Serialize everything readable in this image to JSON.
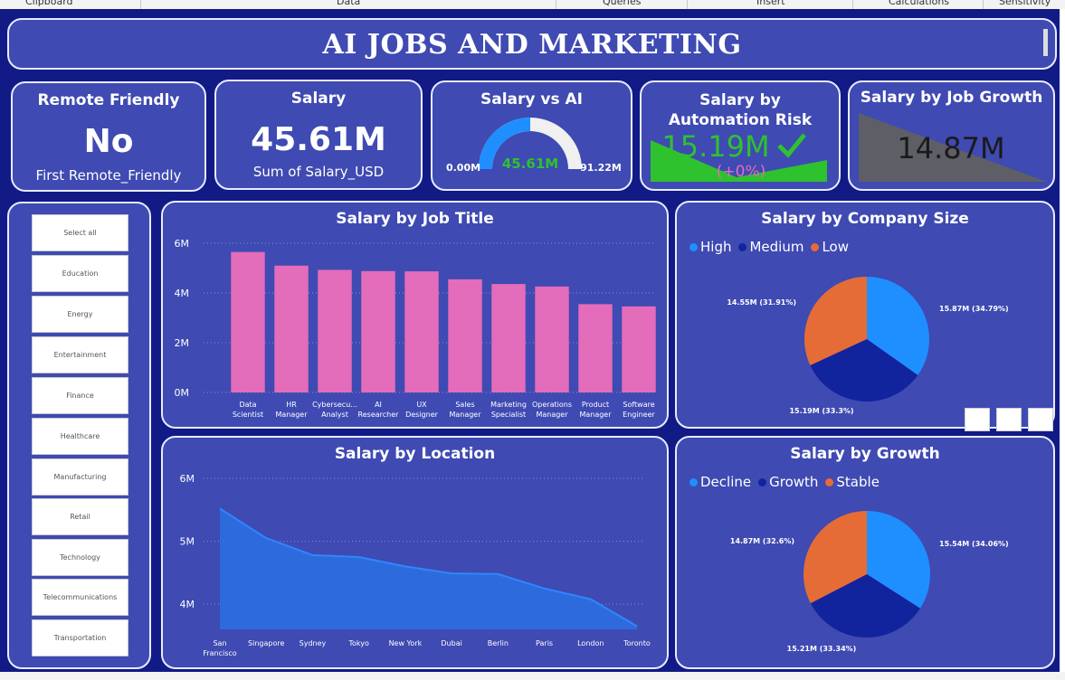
{
  "ribbon": {
    "groups": [
      "Clipboard",
      "Data",
      "Queries",
      "Insert",
      "Calculations",
      "Sensitivity"
    ]
  },
  "header": {
    "title": "AI JOBS AND MARKETING"
  },
  "kpis": {
    "remote": {
      "title": "Remote Friendly",
      "value": "No",
      "subtitle": "First Remote_Friendly"
    },
    "salary": {
      "title": "Salary",
      "value": "45.61M",
      "subtitle": "Sum of Salary_USD"
    },
    "gauge": {
      "title": "Salary vs AI",
      "value": "45.61M",
      "min": "0.00M",
      "max": "91.22M",
      "fill_fraction": 0.5
    },
    "automation": {
      "title": "Salary by Automation Risk",
      "value": "15.19M",
      "change": "(+0%)"
    },
    "growth_kpi": {
      "title": "Salary by Job Growth",
      "value": "14.87M"
    }
  },
  "slicer": {
    "items": [
      "Select all",
      "Education",
      "Energy",
      "Entertainment",
      "Finance",
      "Healthcare",
      "Manufacturing",
      "Retail",
      "Technology",
      "Telecommunications",
      "Transportation"
    ]
  },
  "colors": {
    "canvas": "#121a86",
    "card": "#3f4ab2",
    "bar": "#e36cbb",
    "high": "#1f8fff",
    "medium": "#12239e",
    "low": "#e66c37",
    "line_area": "#2d6bdc",
    "line": "#2f86ff",
    "kpi_green": "#2ec22e"
  },
  "chart_data": [
    {
      "type": "bar",
      "title": "Salary by Job Title",
      "categories": [
        [
          "Data",
          "Scientist"
        ],
        [
          "HR",
          "Manager"
        ],
        [
          "Cybersecu...",
          "Analyst"
        ],
        [
          "AI",
          "Researcher"
        ],
        [
          "UX",
          "Designer"
        ],
        [
          "Sales",
          "Manager"
        ],
        [
          "Marketing",
          "Specialist"
        ],
        [
          "Operations",
          "Manager"
        ],
        [
          "Product",
          "Manager"
        ],
        [
          "Software",
          "Engineer"
        ]
      ],
      "values": [
        5.65,
        5.1,
        4.93,
        4.88,
        4.87,
        4.55,
        4.36,
        4.26,
        3.55,
        3.46
      ],
      "ylim": [
        0,
        6
      ],
      "yticks": [
        "0M",
        "2M",
        "4M",
        "6M"
      ]
    },
    {
      "type": "pie",
      "title": "Salary by Company Size",
      "legend": [
        "High",
        "Medium",
        "Low"
      ],
      "values": [
        15.87,
        15.19,
        14.55
      ],
      "labels": [
        "15.87M (34.79%)",
        "15.19M (33.3%)",
        "14.55M (31.91%)"
      ]
    },
    {
      "type": "area",
      "title": "Salary by Location",
      "categories": [
        [
          "San",
          "Francisco"
        ],
        [
          "Singapore"
        ],
        [
          "Sydney"
        ],
        [
          "Tokyo"
        ],
        [
          "New York"
        ],
        [
          "Dubai"
        ],
        [
          "Berlin"
        ],
        [
          "Paris"
        ],
        [
          "London"
        ],
        [
          "Toronto"
        ]
      ],
      "values": [
        5.52,
        5.05,
        4.78,
        4.75,
        4.6,
        4.49,
        4.48,
        4.25,
        4.08,
        3.65
      ],
      "ylim": [
        3.6,
        6
      ],
      "yticks": [
        "4M",
        "5M",
        "6M"
      ]
    },
    {
      "type": "pie",
      "title": "Salary by Growth",
      "legend": [
        "Decline",
        "Growth",
        "Stable"
      ],
      "values": [
        15.54,
        15.21,
        14.87
      ],
      "labels": [
        "15.54M (34.06%)",
        "15.21M (33.34%)",
        "14.87M (32.6%)"
      ]
    }
  ]
}
